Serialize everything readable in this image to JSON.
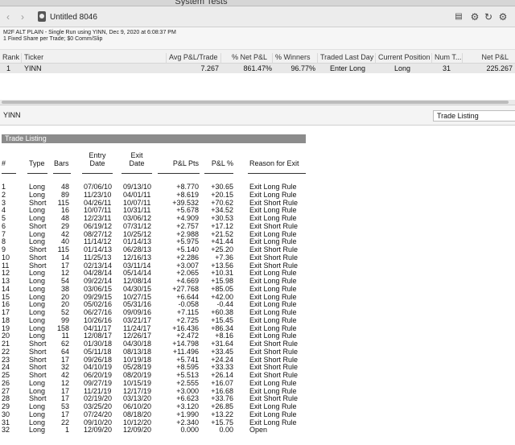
{
  "window": {
    "title": "System Tests",
    "doc_title": "Untitled 8046"
  },
  "toolbar": {
    "back_icon": "chevron-left",
    "forward_icon": "chevron-right",
    "doc_icon": "document",
    "tools": [
      "table-icon",
      "gear-cluster-icon",
      "refresh-icon",
      "settings-gear-icon"
    ]
  },
  "info": {
    "line1": "M2F ALT PLAIN - Single Run using YINN, Dec 9, 2020 at 6:08:37 PM",
    "line2": "1 Fixed Share per Trade; $0 Comm/Slip"
  },
  "results": {
    "headers": [
      "Rank",
      "Ticker",
      "Avg P&L/Trade",
      "% Net P&L",
      "% Winners",
      "Traded Last Day",
      "Current Position",
      "Num T...",
      "Net P&L"
    ],
    "row": {
      "rank": "1",
      "ticker": "YINN",
      "avg": "7.267",
      "net_pct": "861.47%",
      "winners": "96.77%",
      "last_day": "Enter Long",
      "position": "Long",
      "num": "31",
      "net": "225.267"
    }
  },
  "lower": {
    "symbol": "YINN",
    "view_select": "Trade Listing"
  },
  "listing": {
    "title": "Trade Listing",
    "headers": {
      "num": "#",
      "type": "Type",
      "bars": "Bars",
      "entry1": "Entry",
      "entry2": "Date",
      "exit1": "Exit",
      "exit2": "Date",
      "pts": "P&L Pts",
      "pct": "P&L %",
      "reason": "Reason for Exit"
    },
    "rows": [
      [
        "1",
        "Long",
        "48",
        "07/06/10",
        "09/13/10",
        "+8.770",
        "+30.65",
        "Exit Long Rule"
      ],
      [
        "2",
        "Long",
        "89",
        "11/23/10",
        "04/01/11",
        "+8.619",
        "+20.15",
        "Exit Long Rule"
      ],
      [
        "3",
        "Short",
        "115",
        "04/26/11",
        "10/07/11",
        "+39.532",
        "+70.62",
        "Exit Short Rule"
      ],
      [
        "4",
        "Long",
        "16",
        "10/07/11",
        "10/31/11",
        "+5.678",
        "+34.52",
        "Exit Long Rule"
      ],
      [
        "5",
        "Long",
        "48",
        "12/23/11",
        "03/06/12",
        "+4.909",
        "+30.53",
        "Exit Long Rule"
      ],
      [
        "6",
        "Short",
        "29",
        "06/19/12",
        "07/31/12",
        "+2.757",
        "+17.12",
        "Exit Short Rule"
      ],
      [
        "7",
        "Long",
        "42",
        "08/27/12",
        "10/25/12",
        "+2.988",
        "+21.52",
        "Exit Long Rule"
      ],
      [
        "8",
        "Long",
        "40",
        "11/14/12",
        "01/14/13",
        "+5.975",
        "+41.44",
        "Exit Long Rule"
      ],
      [
        "9",
        "Short",
        "115",
        "01/14/13",
        "06/28/13",
        "+5.140",
        "+25.20",
        "Exit Short Rule"
      ],
      [
        "10",
        "Short",
        "14",
        "11/25/13",
        "12/16/13",
        "+2.286",
        "+7.36",
        "Exit Short Rule"
      ],
      [
        "11",
        "Short",
        "17",
        "02/13/14",
        "03/11/14",
        "+3.007",
        "+13.56",
        "Exit Short Rule"
      ],
      [
        "12",
        "Long",
        "12",
        "04/28/14",
        "05/14/14",
        "+2.065",
        "+10.31",
        "Exit Long Rule"
      ],
      [
        "13",
        "Long",
        "54",
        "09/22/14",
        "12/08/14",
        "+4.669",
        "+15.98",
        "Exit Long Rule"
      ],
      [
        "14",
        "Long",
        "38",
        "03/06/15",
        "04/30/15",
        "+27.768",
        "+85.05",
        "Exit Long Rule"
      ],
      [
        "15",
        "Long",
        "20",
        "09/29/15",
        "10/27/15",
        "+6.644",
        "+42.00",
        "Exit Long Rule"
      ],
      [
        "16",
        "Long",
        "20",
        "05/02/16",
        "05/31/16",
        "-0.058",
        "-0.44",
        "Exit Long Rule"
      ],
      [
        "17",
        "Long",
        "52",
        "06/27/16",
        "09/09/16",
        "+7.115",
        "+60.38",
        "Exit Long Rule"
      ],
      [
        "18",
        "Long",
        "99",
        "10/26/16",
        "03/21/17",
        "+2.725",
        "+15.45",
        "Exit Long Rule"
      ],
      [
        "19",
        "Long",
        "158",
        "04/11/17",
        "11/24/17",
        "+16.436",
        "+86.34",
        "Exit Long Rule"
      ],
      [
        "20",
        "Long",
        "11",
        "12/08/17",
        "12/26/17",
        "+2.472",
        "+8.16",
        "Exit Long Rule"
      ],
      [
        "21",
        "Short",
        "62",
        "01/30/18",
        "04/30/18",
        "+14.798",
        "+31.64",
        "Exit Short Rule"
      ],
      [
        "22",
        "Short",
        "64",
        "05/11/18",
        "08/13/18",
        "+11.496",
        "+33.45",
        "Exit Short Rule"
      ],
      [
        "23",
        "Short",
        "17",
        "09/26/18",
        "10/19/18",
        "+5.741",
        "+24.24",
        "Exit Short Rule"
      ],
      [
        "24",
        "Short",
        "32",
        "04/10/19",
        "05/28/19",
        "+8.595",
        "+33.33",
        "Exit Short Rule"
      ],
      [
        "25",
        "Short",
        "42",
        "06/20/19",
        "08/20/19",
        "+5.513",
        "+26.14",
        "Exit Short Rule"
      ],
      [
        "26",
        "Long",
        "12",
        "09/27/19",
        "10/15/19",
        "+2.555",
        "+16.07",
        "Exit Long Rule"
      ],
      [
        "27",
        "Long",
        "17",
        "11/21/19",
        "12/17/19",
        "+3.000",
        "+16.68",
        "Exit Long Rule"
      ],
      [
        "28",
        "Short",
        "17",
        "02/19/20",
        "03/13/20",
        "+6.623",
        "+33.76",
        "Exit Short Rule"
      ],
      [
        "29",
        "Long",
        "53",
        "03/25/20",
        "06/10/20",
        "+3.120",
        "+26.85",
        "Exit Long Rule"
      ],
      [
        "30",
        "Long",
        "17",
        "07/24/20",
        "08/18/20",
        "+1.990",
        "+13.22",
        "Exit Long Rule"
      ],
      [
        "31",
        "Long",
        "22",
        "09/10/20",
        "10/12/20",
        "+2.340",
        "+15.75",
        "Exit Long Rule"
      ],
      [
        "32",
        "Long",
        "1",
        "12/09/20",
        "12/09/20",
        "0.000",
        "0.00",
        "Open"
      ]
    ]
  }
}
